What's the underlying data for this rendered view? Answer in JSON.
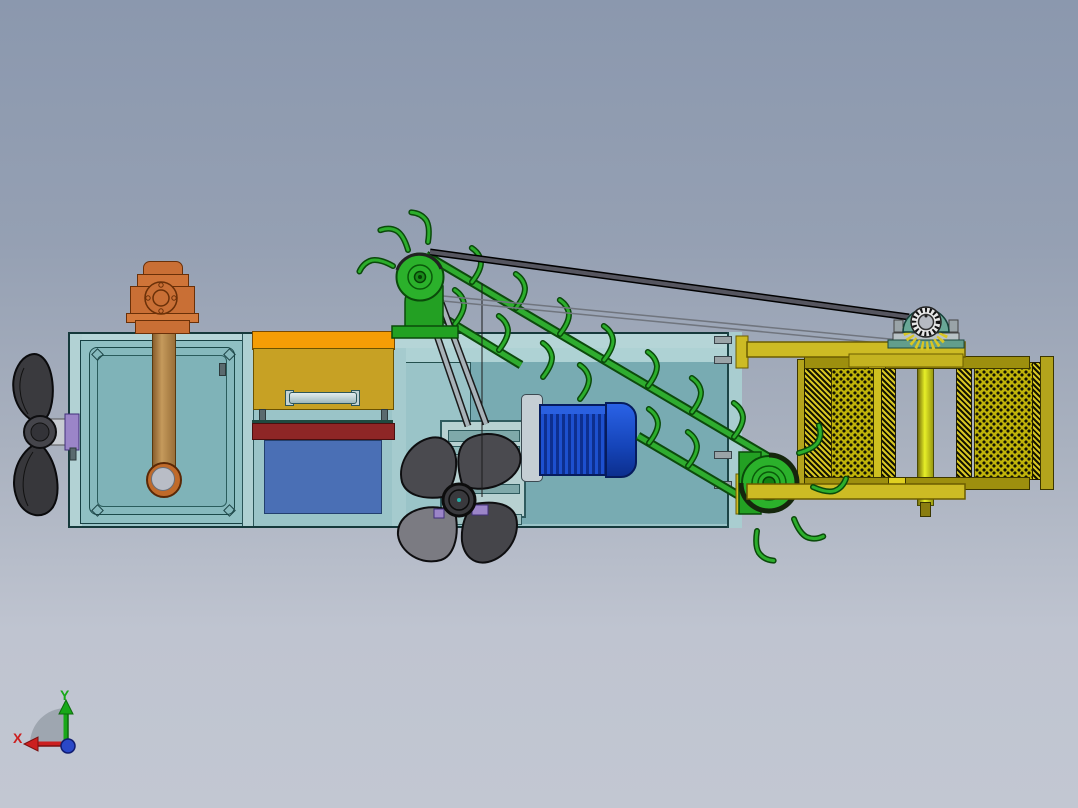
{
  "viewport": {
    "type": "cad-3d-viewport",
    "view": "side-elevation-render",
    "background_top": "#8b98ae",
    "background_bottom": "#c2c7d2"
  },
  "triad": {
    "x_label": "X",
    "y_label": "Y",
    "x_color": "#cc1f1f",
    "y_color": "#18a818",
    "origin_color": "#2a48c8"
  },
  "palette": {
    "hull_teal": "#9ac4c8",
    "hull_rim": "#b5d5d7",
    "tank_panel": "#8fc0c3",
    "interior_wall": "#78abb2",
    "orange_strip": "#f59d05",
    "gold_panel": "#c7a124",
    "red_strip": "#8e2626",
    "blue_panel": "#4a6fb5",
    "motor_blue": "#1d50cf",
    "machine_green": "#2bb12b",
    "basket_yellow": "#c0b300",
    "arm_yellow": "#cdbb24",
    "copper_pump": "#c96f35",
    "pipe_tan": "#b98a4d",
    "coupling_purple": "#9b85c8",
    "propeller_gray": "#4a4a4f",
    "belt_gray": "#565660"
  },
  "components": [
    "hull",
    "ballast-tank",
    "suction-pipe",
    "pump",
    "bow-propeller",
    "orange-cover",
    "gold-panel",
    "handle",
    "red-ledge",
    "blue-panel",
    "gearbox",
    "drive-motor",
    "main-propeller",
    "rake-conveyor-with-tines",
    "upper-drive-pulley",
    "lower-drive-pulley",
    "drive-belts",
    "collection-basket",
    "basket-shaft",
    "bearing-unit",
    "support-arms",
    "origin-triad"
  ]
}
